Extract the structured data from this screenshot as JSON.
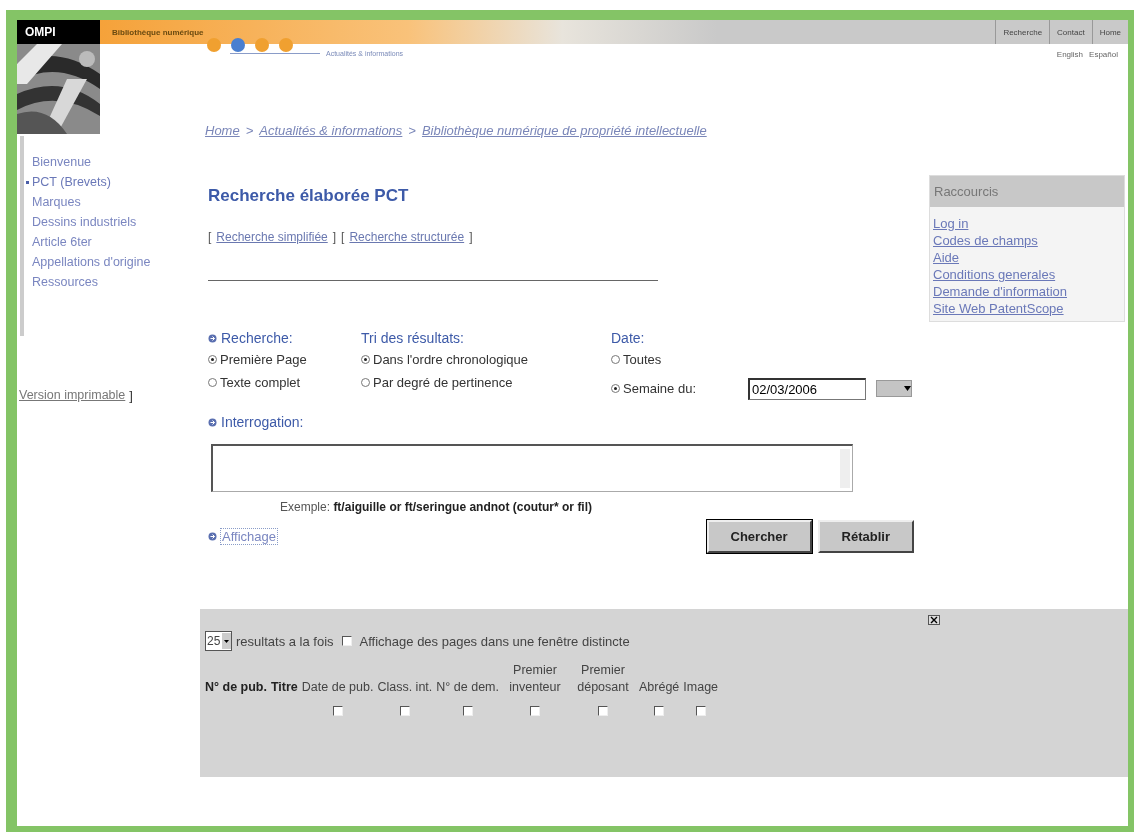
{
  "header": {
    "logo": "OMPI",
    "section": "Bibliothèque numérique",
    "subsection": "Actualités & informations",
    "top_links": [
      "Recherche",
      "Contact",
      "Home"
    ],
    "languages": [
      "English",
      "Español"
    ],
    "steps": [
      {
        "selected": false
      },
      {
        "selected": true
      },
      {
        "selected": false
      },
      {
        "selected": false
      }
    ]
  },
  "breadcrumb": [
    {
      "label": "Home"
    },
    {
      "separator": ">",
      "label": "Actualités & informations"
    },
    {
      "separator": ">",
      "label": "Bibliothèque numérique de propriété intellectuelle"
    }
  ],
  "sidebar": {
    "items": [
      {
        "label": "Bienvenue",
        "selected": false
      },
      {
        "label": "PCT (Brevets)",
        "selected": true
      },
      {
        "label": "Marques",
        "selected": false
      },
      {
        "label": "Dessins industriels",
        "selected": false
      },
      {
        "label": "Article 6ter",
        "selected": false
      },
      {
        "label": "Appellations d'origine",
        "selected": false
      },
      {
        "label": "Ressources",
        "selected": false
      }
    ],
    "print_link": "Version imprimable",
    "print_bracket": "]"
  },
  "title": "Recherche élaborée PCT",
  "mode_links": [
    {
      "open": "[",
      "label": "Recherche simplifiée",
      "close": "]"
    },
    {
      "open": "[",
      "label": "Recherche structurée",
      "close": "]"
    }
  ],
  "options": [
    {
      "heading": "Recherche:",
      "radios": [
        {
          "label": "Première Page",
          "selected": true
        },
        {
          "label": "Texte complet",
          "selected": false
        }
      ]
    },
    {
      "heading": "Tri des résultats:",
      "radios": [
        {
          "label": "Dans l'ordre chronologique",
          "selected": true
        },
        {
          "label": "Par degré de pertinence",
          "selected": false
        }
      ]
    },
    {
      "heading": "Date:",
      "radios": [
        {
          "label": "Toutes",
          "selected": false
        },
        {
          "label": "Semaine du:",
          "selected": true,
          "date": "02/03/2006"
        }
      ]
    }
  ],
  "query": {
    "heading": "Interrogation:",
    "example_label": "Exemple:",
    "example": "ft/aiguille or ft/seringue andnot (coutur* or fil)"
  },
  "display_link": "Affichage",
  "buttons": [
    "Chercher",
    "Rétablir"
  ],
  "results": {
    "per_page": "25",
    "per_page_label": "resultats a la fois",
    "new_window": {
      "label": "Affichage des pages dans une fenêtre distincte",
      "checked": false
    },
    "columns": [
      {
        "label": "N° de pub.",
        "kind": "fixed"
      },
      {
        "label": "Titre",
        "kind": "fixed"
      },
      {
        "label": "Date de pub.",
        "kind": "optional",
        "checked": false
      },
      {
        "label": "Class. int.",
        "kind": "optional",
        "checked": false
      },
      {
        "label": "N° de dem.",
        "kind": "optional",
        "checked": false
      },
      {
        "label": "Premier inventeur",
        "kind": "optional",
        "checked": false
      },
      {
        "label": "Premier déposant",
        "kind": "optional",
        "checked": false
      },
      {
        "label": "Abrégé",
        "kind": "optional",
        "checked": false
      },
      {
        "label": "Image",
        "kind": "optional",
        "checked": false
      }
    ]
  },
  "shortcuts": {
    "title": "Raccourcis",
    "links": [
      "Log in",
      "Codes de champs",
      "Aide",
      "Conditions generales",
      "Demande d'information",
      "Site Web PatentScope"
    ]
  }
}
